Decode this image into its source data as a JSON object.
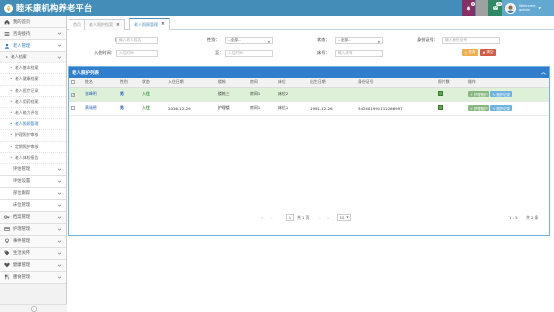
{
  "app": {
    "title": "睦禾康机构养老平台"
  },
  "topbar": {
    "bell_badge": "8",
    "mail_badge": "20",
    "user_greeting": "Welcome,",
    "user_name": "admin"
  },
  "sidebar": {
    "items": [
      {
        "label": "我的首页",
        "icon": "home-icon"
      },
      {
        "label": "咨询接待",
        "icon": "list-icon"
      },
      {
        "label": "老人管理",
        "icon": "user-icon",
        "active": true
      }
    ],
    "sub_group": {
      "label": "老人档案"
    },
    "subitems": [
      {
        "label": "老人基本档案"
      },
      {
        "label": "老人健康档案"
      },
      {
        "label": "老人医疗记录"
      },
      {
        "label": "老人用药档案"
      },
      {
        "label": "老人能力评估"
      },
      {
        "label": "老人照顾管理",
        "active": true
      },
      {
        "label": "护理照护审核"
      },
      {
        "label": "定期照护审核"
      },
      {
        "label": "老人体检报告"
      }
    ],
    "groups2": [
      {
        "label": "评估管理"
      },
      {
        "label": "评估设置"
      },
      {
        "label": "部位跟踪"
      },
      {
        "label": "床位管理"
      }
    ],
    "groups3": [
      {
        "label": "档案管理",
        "icon": "key-icon"
      },
      {
        "label": "护理管理",
        "icon": "card-icon"
      },
      {
        "label": "事件管理",
        "icon": "bulb-icon"
      },
      {
        "label": "生活关怀",
        "icon": "tag-icon"
      },
      {
        "label": "健康管理",
        "icon": "heart-icon"
      },
      {
        "label": "膳食管理",
        "icon": "fork-icon"
      }
    ]
  },
  "tabs": [
    {
      "label": "首页"
    },
    {
      "label": "老人照护档案"
    },
    {
      "label": "老人照顾管理",
      "active": true
    }
  ],
  "search": {
    "name_label": "姓名：",
    "name_placeholder": "输入老人姓名",
    "gender_label": "性别：",
    "gender_value": "--全部--",
    "status_label": "状态：",
    "status_value": "--全部--",
    "id_label": "身份证号：",
    "id_placeholder": "输入身份证号",
    "date_label": "入住时间：",
    "date_from_placeholder": "入住时间",
    "to_label": "至：",
    "date_to_placeholder": "入住时间",
    "bed_label": "床号：",
    "bed_placeholder": "输入床号",
    "search_btn": "查询",
    "clear_btn": "清空"
  },
  "panel": {
    "title": "老人照护列表"
  },
  "table": {
    "headers": [
      "",
      "姓名",
      "性别",
      "状态",
      "入住日期",
      "楼栋",
      "房间",
      "床位",
      "出生日期",
      "身份证号",
      "照片数",
      "操作"
    ],
    "rows": [
      {
        "checked": "✓",
        "name": "张峰明",
        "gender": "男",
        "status": "入住",
        "date": "",
        "building": "楼栋三",
        "room": "房间1",
        "bed": "床位2",
        "birth": "",
        "idno": "",
        "selected": true
      },
      {
        "checked": "",
        "name": "黄瑞德",
        "gender": "男",
        "status": "入住",
        "date": "2016-12-29",
        "building": "护理楼",
        "room": "房间1",
        "bed": "床位1",
        "birth": "1991-12-26",
        "idno": "342401991112266997",
        "selected": false
      }
    ],
    "action1": "+ 护理照护",
    "action2": "✎ 照护记录"
  },
  "pager": {
    "first": "«",
    "prev": "‹",
    "page": "1",
    "of": "共 1 页",
    "next": "›",
    "last": "»",
    "size": "10",
    "range": "1 - 2",
    "total": "共 2 条"
  },
  "colors": {
    "topbar": "#438eb9",
    "panel_header": "#307ecc",
    "search_btn": "#f0ad4e",
    "clear_btn": "#d15b47",
    "action1": "#87b87f",
    "action2": "#6fb3e0"
  }
}
